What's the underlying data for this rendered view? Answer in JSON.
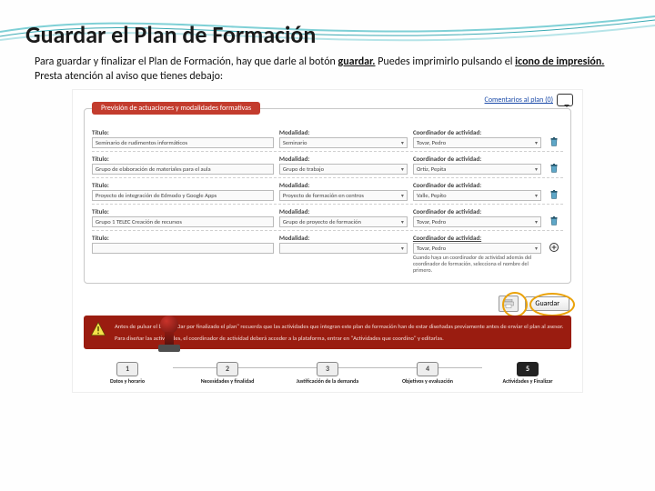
{
  "heading": "Guardar el Plan de Formación",
  "intro_parts": {
    "p1": "Para guardar y finalizar el Plan de Formación, hay que darle al botón ",
    "b1": "guardar.",
    "p2": " Puedes imprimirlo pulsando el ",
    "b2": "icono de impresión.",
    "p3": " Presta atención al aviso que tienes debajo:"
  },
  "comments_link": "Comentarios al plan (0)",
  "panel_header": "Previsión de actuaciones y modalidades formativas",
  "labels": {
    "titulo": "Título:",
    "modalidad": "Modalidad:",
    "coord": "Coordinador de actividad:"
  },
  "rows": [
    {
      "titulo": "Seminario de rudimentos informáticos",
      "modalidad": "Seminario",
      "coord": "Tovar, Pedro"
    },
    {
      "titulo": "Grupo de elaboración de materiales para el aula",
      "modalidad": "Grupo de trabajo",
      "coord": "Ortiz, Pepita"
    },
    {
      "titulo": "Proyecto de integración de Edmodo y Google Apps",
      "modalidad": "Proyecto de formación en centros",
      "coord": "Valle, Pepito"
    },
    {
      "titulo": "Grupo 1 TELEC Creación de recursos",
      "modalidad": "Grupo de proyecto de formación",
      "coord": "Tovar, Pedro"
    }
  ],
  "new_row": {
    "titulo": "",
    "modalidad": "",
    "coord": "Tovar, Pedro",
    "hint": "Cuando haya un coordinador de actividad además del coordinador de formación, selecciona el nombre del primero."
  },
  "save_label": "Guardar",
  "warning": {
    "line1": "Antes de pulsar el botón \"Dar por finalizado el plan\" recuerda que las actividades que integran este plan de formación han de estar diseñadas previamente antes de enviar el plan al asesor.",
    "line2": "Para diseñar las actividades, el coordinador de actividad deberá acceder a la plataforma, entrar en \"Actividades que coordino\" y editarlas."
  },
  "steps": [
    {
      "n": "1",
      "label": "Datos y horario"
    },
    {
      "n": "2",
      "label": "Necesidades y finalidad"
    },
    {
      "n": "3",
      "label": "Justificación de la demanda"
    },
    {
      "n": "4",
      "label": "Objetivos y evaluación"
    },
    {
      "n": "5",
      "label": "Actividades y Finalizar"
    }
  ]
}
